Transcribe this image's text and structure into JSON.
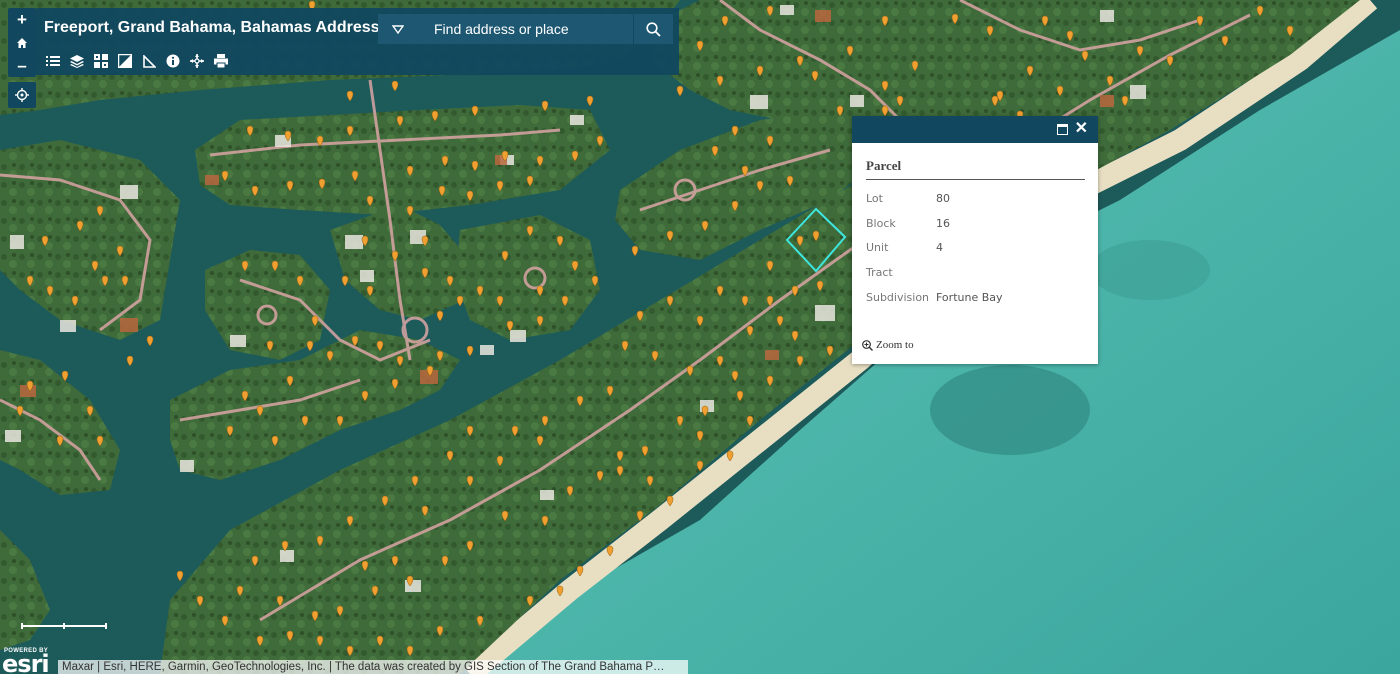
{
  "app": {
    "title": "Freeport, Grand Bahama, Bahamas Addresses"
  },
  "search": {
    "placeholder": "Find address or place",
    "dropdown_icon": "triangle-down-icon",
    "button_icon": "search-icon"
  },
  "zoom": {
    "in_label": "+",
    "out_label": "–",
    "home_icon": "home-icon",
    "locate_icon": "locate-icon"
  },
  "tools": [
    {
      "name": "legend-icon"
    },
    {
      "name": "layers-icon"
    },
    {
      "name": "basemap-gallery-icon"
    },
    {
      "name": "overview-map-icon"
    },
    {
      "name": "measure-icon"
    },
    {
      "name": "about-icon"
    },
    {
      "name": "directions-icon"
    },
    {
      "name": "print-icon"
    }
  ],
  "popup": {
    "title": "Parcel",
    "fields": [
      {
        "key": "Lot",
        "value": "80"
      },
      {
        "key": "Block",
        "value": "16"
      },
      {
        "key": "Unit",
        "value": "4"
      },
      {
        "key": "Tract",
        "value": ""
      },
      {
        "key": "Subdivision",
        "value": "Fortune Bay"
      }
    ],
    "zoom_to_label": "Zoom to",
    "close_label": "✕"
  },
  "attribution": {
    "powered_by": "POWERED BY",
    "logo": "esri",
    "text": "Maxar | Esri, HERE, Garmin, GeoTechnologies, Inc. | The data was created by GIS Section of The Grand Bahama P…"
  },
  "colors": {
    "panel": "#11485f",
    "land": "#3e6b3a",
    "canal": "#1f5d5c",
    "sea": "#4fb6ac",
    "beach": "#e9e0c6",
    "road": "#d6a3a3",
    "pin": "#f0a030",
    "selection": "#3ee6e0"
  }
}
